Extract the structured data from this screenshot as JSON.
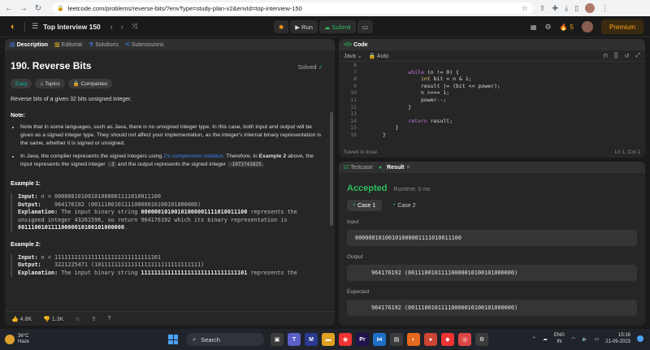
{
  "browser": {
    "url": "leetcode.com/problems/reverse-bits/?envType=study-plan-v2&envId=top-interview-150"
  },
  "nav": {
    "list_title": "Top Interview 150",
    "run_label": "Run",
    "submit_label": "Submit",
    "streak": "5",
    "premium_label": "Premium"
  },
  "description": {
    "tabs": [
      "Description",
      "Editorial",
      "Solutions",
      "Submissions"
    ],
    "title": "190. Reverse Bits",
    "solved_label": "Solved",
    "tags": [
      "Easy",
      "Topics",
      "Companies"
    ],
    "statement": "Reverse bits of a given 32 bits unsigned integer.",
    "note_heading": "Note:",
    "note1": "Note that in some languages, such as Java, there is no unsigned integer type. In this case, both input and output will be given as a signed integer type. They should not affect your implementation, as the integer's internal binary representation is the same, whether it is signed or unsigned.",
    "note2_a": "In Java, the compiler represents the signed integers using ",
    "note2_link": "2's complement notation",
    "note2_b": ". Therefore, in ",
    "note2_bold": "Example 2",
    "note2_c": " above, the input represents the signed integer ",
    "note2_code1": "-3",
    "note2_d": " and the output represents the signed integer ",
    "note2_code2": "-1073741825",
    "note2_e": ".",
    "example1": {
      "heading": "Example 1:",
      "input_label": "Input:",
      "input": "n = 00000010100101000001111010011100",
      "output_label": "Output:",
      "output": "964176192 (00111001011110000010100101000000)",
      "explanation_label": "Explanation:",
      "explanation_a": "The input binary string ",
      "explanation_bold1": "00000010100101000001111010011100",
      "explanation_b": " represents the unsigned integer 43261596, so return 964176192 which its binary representation is ",
      "explanation_bold2": "00111001011110000010100101000000",
      "explanation_c": "."
    },
    "example2": {
      "heading": "Example 2:",
      "input_label": "Input:",
      "input": "n = 11111111111111111111111111111101",
      "output_label": "Output:",
      "output": "3221225471 (10111111111111111111111111111111)",
      "explanation_label": "Explanation:",
      "explanation_a": "The input binary string ",
      "explanation_bold1": "11111111111111111111111111111101",
      "explanation_b": " represents the"
    },
    "likes": "4.8K",
    "dislikes": "1.3K"
  },
  "code": {
    "tab_label": "Code",
    "language": "Java",
    "mode": "Auto",
    "lines": [
      {
        "n": "6",
        "t": ""
      },
      {
        "n": "7",
        "t": "        while (n != 0) {"
      },
      {
        "n": "8",
        "t": "            int bit = n & 1;"
      },
      {
        "n": "9",
        "t": "            result |= (bit << power);"
      },
      {
        "n": "10",
        "t": "            n >>>= 1;"
      },
      {
        "n": "11",
        "t": "            power--;"
      },
      {
        "n": "12",
        "t": "        }"
      },
      {
        "n": "13",
        "t": ""
      },
      {
        "n": "14",
        "t": "        return result;"
      },
      {
        "n": "15",
        "t": "    }"
      },
      {
        "n": "16",
        "t": "}"
      }
    ],
    "status_left": "Saved to local",
    "status_right": "Ln 1, Col 1"
  },
  "result": {
    "tabs": [
      "Testcase",
      "Result"
    ],
    "verdict": "Accepted",
    "runtime": "Runtime: 0 ms",
    "cases": [
      "Case 1",
      "Case 2"
    ],
    "input_label": "Input",
    "input_value": "00000010100101000001111010011100",
    "output_label": "Output",
    "output_value": "964176192 (00111001011110000010100101000000)",
    "expected_label": "Expected",
    "expected_value": "964176192 (00111001011110000010100101000000)"
  },
  "taskbar": {
    "temp": "36°C",
    "weather": "Haze",
    "search": "Search",
    "lang1": "ENG",
    "lang2": "IN",
    "time": "15:16",
    "date": "21-09-2023"
  }
}
